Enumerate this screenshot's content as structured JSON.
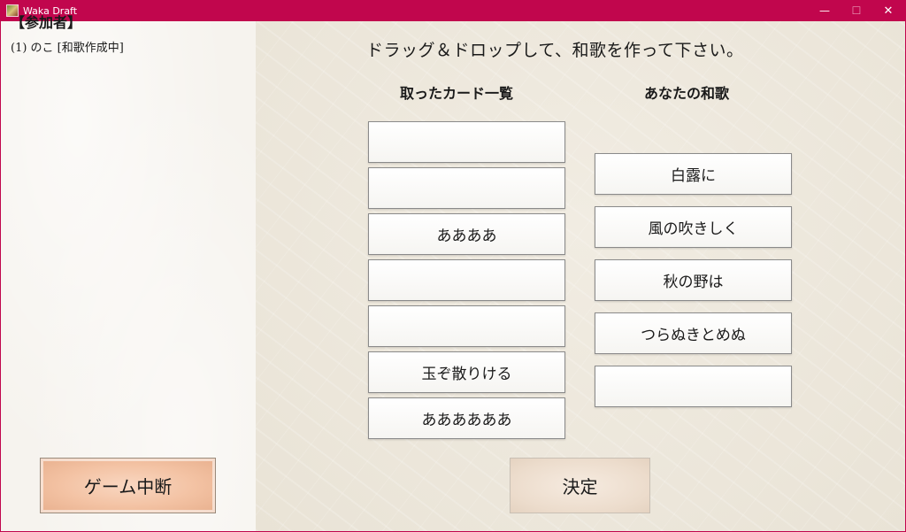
{
  "window": {
    "title": "Waka Draft",
    "minimize_glyph": "—",
    "maximize_glyph": "☐",
    "close_glyph": "✕"
  },
  "sidebar": {
    "header": "【参加者】",
    "participants": [
      "(1) のこ [和歌作成中]"
    ]
  },
  "main": {
    "instruction": "ドラッグ＆ドロップして、和歌を作って下さい。",
    "taken_cards_header": "取ったカード一覧",
    "your_waka_header": "あなたの和歌",
    "taken_cards": [
      "",
      "",
      "ああああ",
      "",
      "",
      "玉ぞ散りける",
      "ああああああ"
    ],
    "waka_cards": [
      "白露に",
      "風の吹きしく",
      "秋の野は",
      "つらぬきとめぬ",
      ""
    ]
  },
  "buttons": {
    "quit_label": "ゲーム中断",
    "decide_label": "決定"
  },
  "colors": {
    "titlebar": "#c1064d",
    "quit_button": "#f3c2a3",
    "decide_button": "#ecdccc"
  }
}
